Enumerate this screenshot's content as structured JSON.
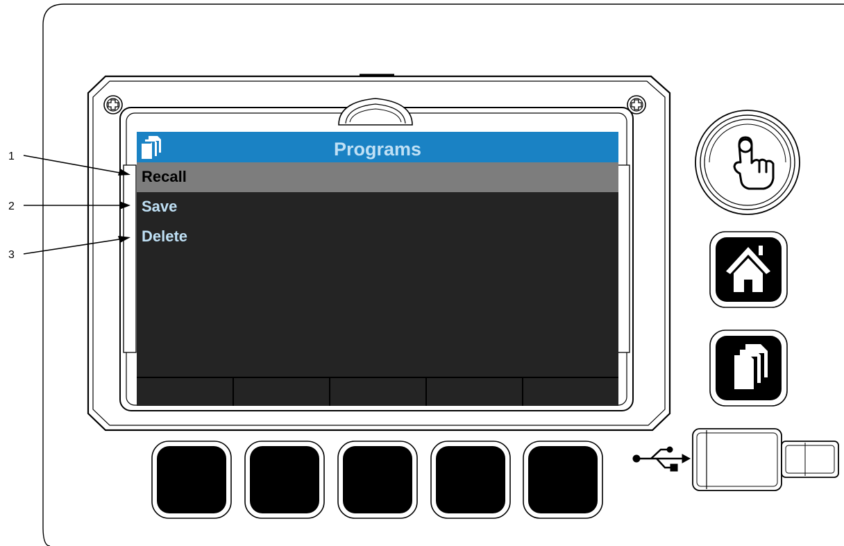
{
  "screen": {
    "title": "Programs",
    "header_color": "#1a82c4",
    "title_color": "#bfe0f5",
    "background": "#242424",
    "menu": [
      {
        "label": "Recall",
        "selected": true
      },
      {
        "label": "Save",
        "selected": false
      },
      {
        "label": "Delete",
        "selected": false
      }
    ],
    "selected_row_color": "#7d7d7d",
    "selected_text_color": "#000000",
    "unselected_text_color": "#bfe0f5"
  },
  "callouts": [
    {
      "number": "1",
      "target": "Recall"
    },
    {
      "number": "2",
      "target": "Save"
    },
    {
      "number": "3",
      "target": "Delete"
    }
  ],
  "side_buttons": [
    {
      "name": "touch-button",
      "icon": "pointing-hand-icon"
    },
    {
      "name": "home-button",
      "icon": "home-icon"
    },
    {
      "name": "programs-button",
      "icon": "pages-icon"
    }
  ],
  "softkeys_count": 5,
  "usb": {
    "icon": "usb-icon"
  }
}
